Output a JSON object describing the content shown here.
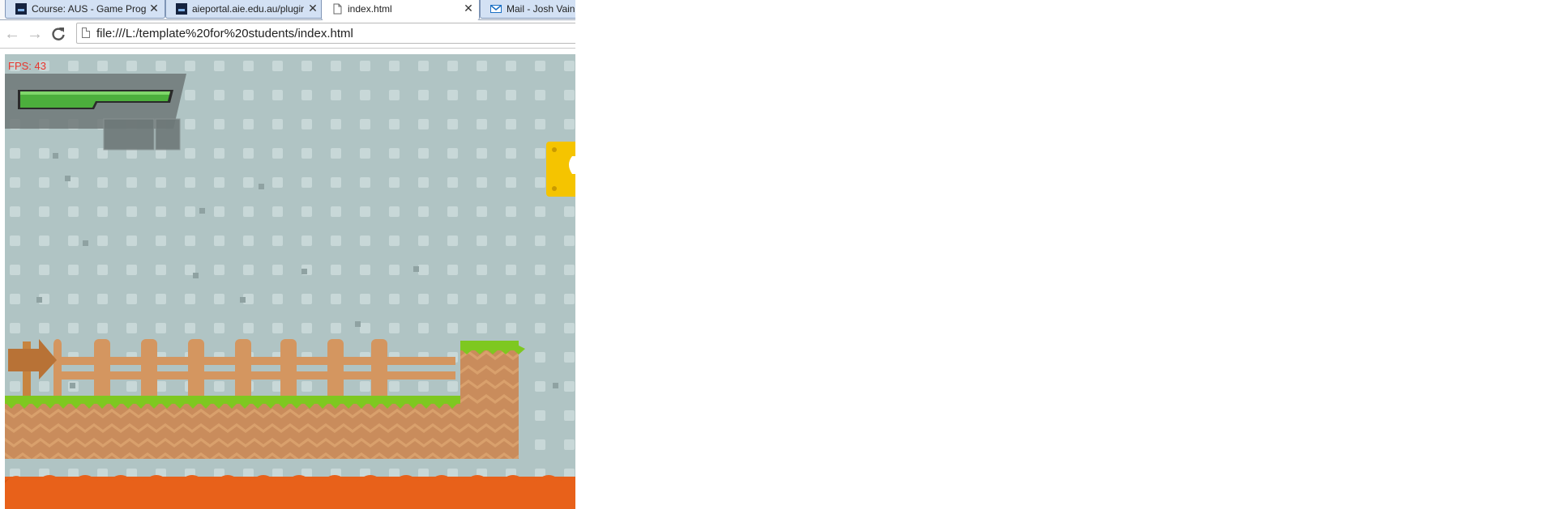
{
  "browser": {
    "tabs": [
      {
        "title": "Course: AUS - Game Prog",
        "icon": "aie-icon",
        "active": false
      },
      {
        "title": "aieportal.aie.edu.au/plugir",
        "icon": "aie-icon",
        "active": false
      },
      {
        "title": "index.html",
        "icon": "page-icon",
        "active": true
      },
      {
        "title": "Mail - Josh Vains",
        "icon": "mail-icon",
        "active": false
      }
    ],
    "url": "file:///L:/template%20for%20students/index.html"
  },
  "game": {
    "fps_text": "FPS: 43",
    "health_fill": 1.0,
    "colors": {
      "sky": "#b0c4c4",
      "grass": "#7ec820",
      "dirt": "#c98c5c",
      "fence": "#d49660",
      "lava": "#e8611a",
      "question_block": "#f5c400",
      "health_bar": "#4caf3c",
      "fps": "#e8342b"
    }
  }
}
